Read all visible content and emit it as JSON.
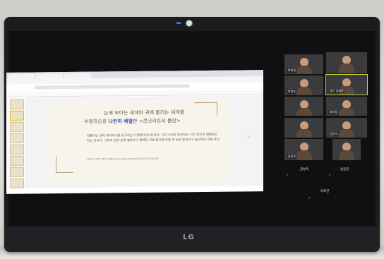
{
  "device": {
    "brand": "LG"
  },
  "slide": {
    "title_line1": "눈에 보이는 세계와 귀에 들리는 세계를",
    "title_line2_pre": "수평적으로 ",
    "title_line2_bold": "나란히 배열",
    "title_line2_post": "한 <콘크리트의 불안>",
    "body": "정용미는 설마 테이러니를 탐구하는 다큐멘터리스트이다. 그의 시선은 탐구하는 지적 것이라 애매하는 자신 것이다. 그래의 전혀 눈에 행하하고 맹해한 것을 본다면 다른 쪽 눈은 동하이고 놀라하라 것을 본다.",
    "source": "2016 문 정희 희망 하 http://www.www.3d.net/sb/2016/7/8 #p3030"
  },
  "gallery": {
    "tiles": [
      {
        "name": "박희정"
      },
      {
        "name": ""
      },
      {
        "name": "박영순"
      },
      {
        "name": "장윤 김혜정"
      },
      {
        "name": ""
      },
      {
        "name": "회서정"
      },
      {
        "name": ""
      },
      {
        "name": "김윤조"
      },
      {
        "name": "장성옥"
      },
      {
        "name": ""
      }
    ],
    "labels": {
      "left_bottom": "장성옥",
      "right_bottom": "남응란",
      "center_bottom": "박조란"
    }
  }
}
